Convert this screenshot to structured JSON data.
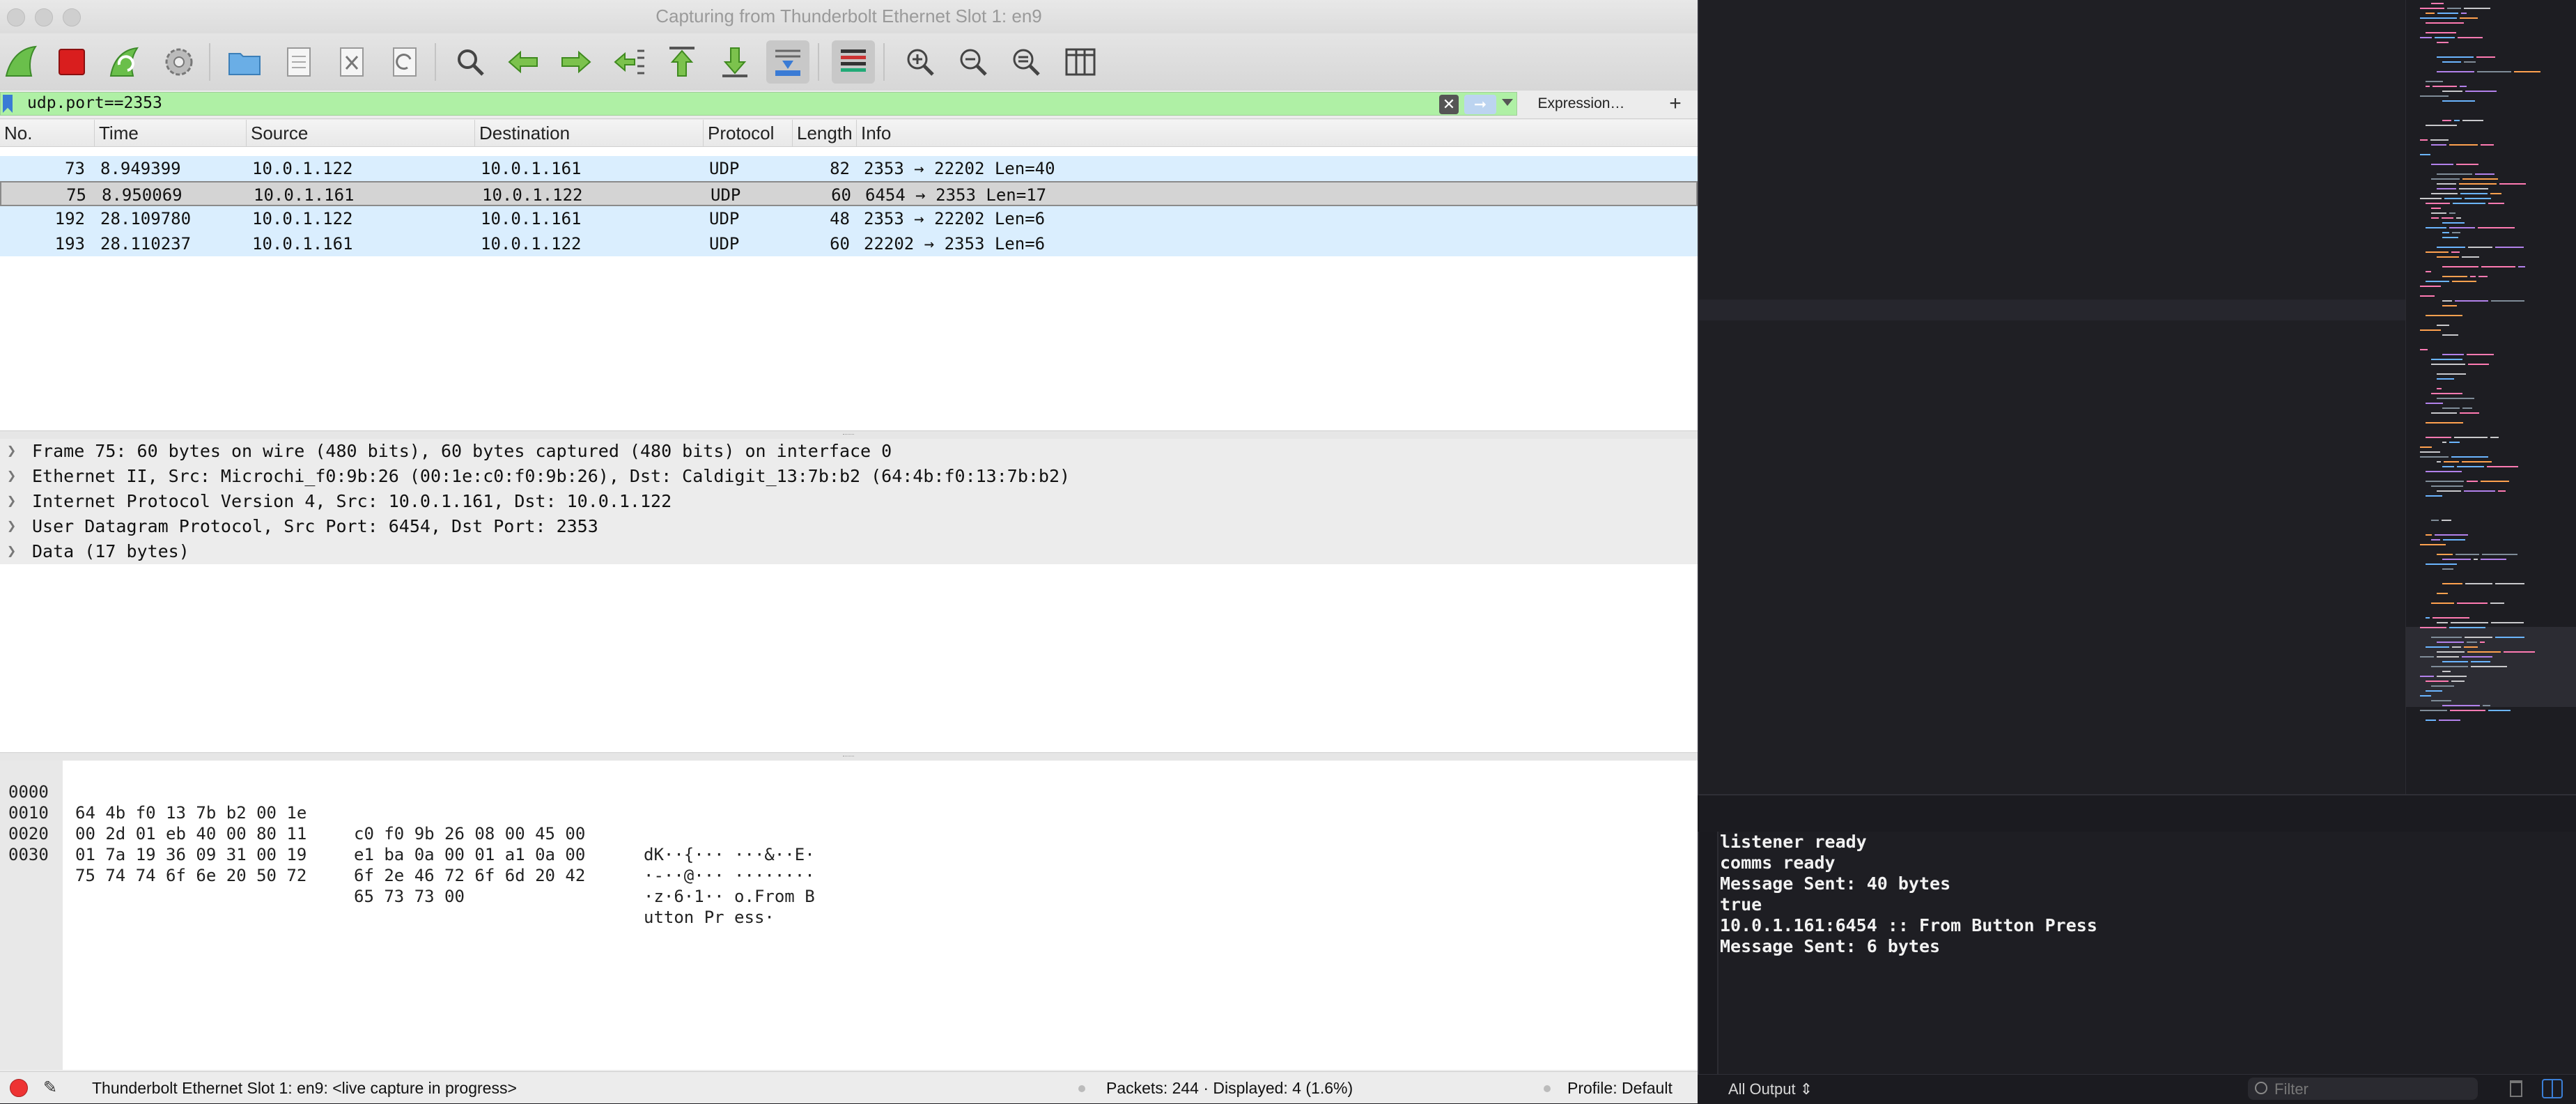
{
  "window": {
    "title": "Capturing from Thunderbolt Ethernet Slot 1: en9"
  },
  "toolbar": {
    "buttons": [
      "start-capture-icon",
      "stop-capture-icon",
      "restart-capture-icon",
      "capture-options-icon",
      "open-file-icon",
      "save-file-icon",
      "close-file-icon",
      "reload-icon",
      "find-packet-icon",
      "go-back-icon",
      "go-forward-icon",
      "go-to-packet-icon",
      "first-packet-icon",
      "last-packet-icon",
      "autoscroll-icon",
      "colorize-icon",
      "zoom-in-icon",
      "zoom-out-icon",
      "normal-size-icon",
      "resize-columns-icon"
    ]
  },
  "filter": {
    "value": "udp.port==2353",
    "expression_label": "Expression…",
    "add_label": "+",
    "clear_icon": "clear-icon",
    "apply_icon": "apply-arrow-icon"
  },
  "packet_list": {
    "columns": [
      "No.",
      "Time",
      "Source",
      "Destination",
      "Protocol",
      "Length",
      "Info"
    ],
    "rows": [
      {
        "no": "73",
        "time": "8.949399",
        "source": "10.0.1.122",
        "destination": "10.0.1.161",
        "protocol": "UDP",
        "length": "82",
        "info": "2353 → 22202 Len=40",
        "selected": false
      },
      {
        "no": "75",
        "time": "8.950069",
        "source": "10.0.1.161",
        "destination": "10.0.1.122",
        "protocol": "UDP",
        "length": "60",
        "info": "6454 → 2353 Len=17",
        "selected": true
      },
      {
        "no": "192",
        "time": "28.109780",
        "source": "10.0.1.122",
        "destination": "10.0.1.161",
        "protocol": "UDP",
        "length": "48",
        "info": "2353 → 22202 Len=6",
        "selected": false
      },
      {
        "no": "193",
        "time": "28.110237",
        "source": "10.0.1.161",
        "destination": "10.0.1.122",
        "protocol": "UDP",
        "length": "60",
        "info": "22202 → 2353 Len=6",
        "selected": false
      }
    ]
  },
  "details": {
    "rows": [
      "Frame 75: 60 bytes on wire (480 bits), 60 bytes captured (480 bits) on interface 0",
      "Ethernet II, Src: Microchi_f0:9b:26 (00:1e:c0:f0:9b:26), Dst: Caldigit_13:7b:b2 (64:4b:f0:13:7b:b2)",
      "Internet Protocol Version 4, Src: 10.0.1.161, Dst: 10.0.1.122",
      "User Datagram Protocol, Src Port: 6454, Dst Port: 2353",
      "Data (17 bytes)"
    ]
  },
  "bytes": {
    "rows": [
      {
        "offset": "0000",
        "hex1": "64 4b f0 13 7b b2 00 1e",
        "hex2": "c0 f0 9b 26 08 00 45 00",
        "ascii": "dK··{··· ···&··E·"
      },
      {
        "offset": "0010",
        "hex1": "00 2d 01 eb 40 00 80 11",
        "hex2": "e1 ba 0a 00 01 a1 0a 00",
        "ascii": "·-··@··· ········"
      },
      {
        "offset": "0020",
        "hex1": "01 7a 19 36 09 31 00 19",
        "hex2": "6f 2e 46 72 6f 6d 20 42",
        "ascii": "·z·6·1·· o.From B"
      },
      {
        "offset": "0030",
        "hex1": "75 74 74 6f 6e 20 50 72",
        "hex2": "65 73 73 00",
        "ascii": "utton Pr ess·"
      }
    ]
  },
  "status": {
    "interface": "Thunderbolt Ethernet Slot 1: en9: <live capture in progress>",
    "packets": "Packets: 244 · Displayed: 4 (1.6%)",
    "profile": "Profile: Default"
  },
  "console": {
    "lines": [
      "listener ready",
      "comms ready",
      "Message Sent: 40 bytes",
      "true",
      "10.0.1.161:6454 :: From Button Press",
      "Message Sent: 6 bytes"
    ],
    "output_selector": "All Output ⇕",
    "filter_placeholder": "Filter"
  },
  "colors": {
    "filter_valid": "#aff0a5",
    "udp_row": "#daeefe",
    "selected_row": "#d4d4d4",
    "editor_bg": "#1f1f24",
    "console_text": "#f2f2f2"
  }
}
